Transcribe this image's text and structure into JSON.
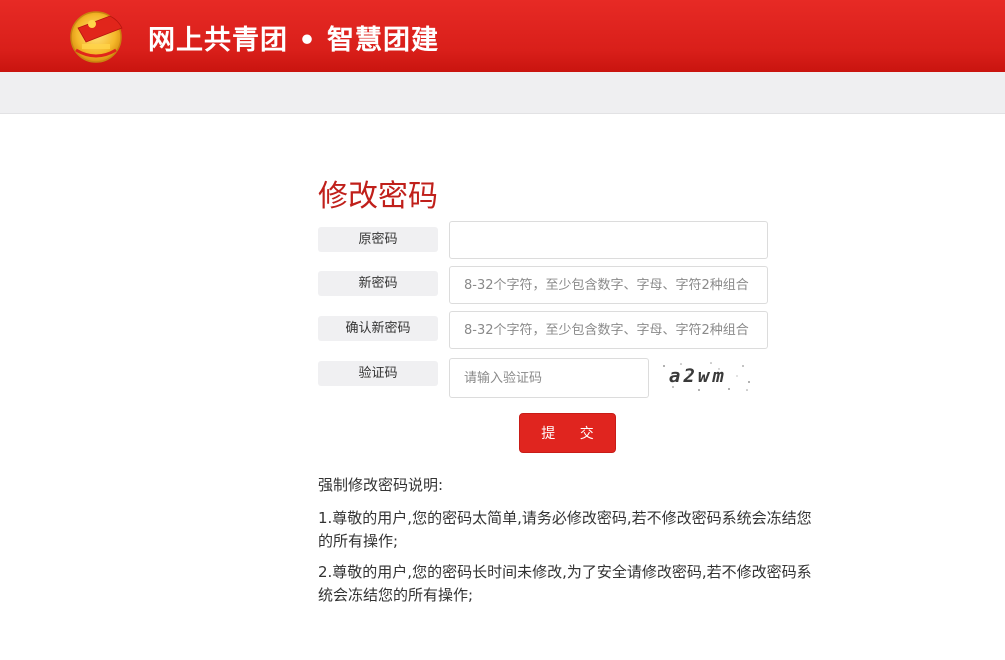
{
  "header": {
    "site_title": "网上共青团 • 智慧团建",
    "logo_icon": "youth-league-emblem-icon",
    "brand_red": "#e0251f"
  },
  "form": {
    "title": "修改密码",
    "fields": [
      {
        "label": "原密码",
        "value": "",
        "placeholder": ""
      },
      {
        "label": "新密码",
        "value": "",
        "placeholder": "8-32个字符，至少包含数字、字母、字符2种组合"
      },
      {
        "label": "确认新密码",
        "value": "",
        "placeholder": "8-32个字符，至少包含数字、字母、字符2种组合"
      },
      {
        "label": "验证码",
        "value": "",
        "placeholder": "请输入验证码"
      }
    ],
    "captcha_text": "a2wm",
    "submit_label": "提 交"
  },
  "notes": {
    "title": "强制修改密码说明:",
    "items": [
      "1.尊敬的用户,您的密码太简单,请务必修改密码,若不修改密码系统会冻结您的所有操作;",
      "2.尊敬的用户,您的密码长时间未修改,为了安全请修改密码,若不修改密码系统会冻结您的所有操作;"
    ]
  }
}
